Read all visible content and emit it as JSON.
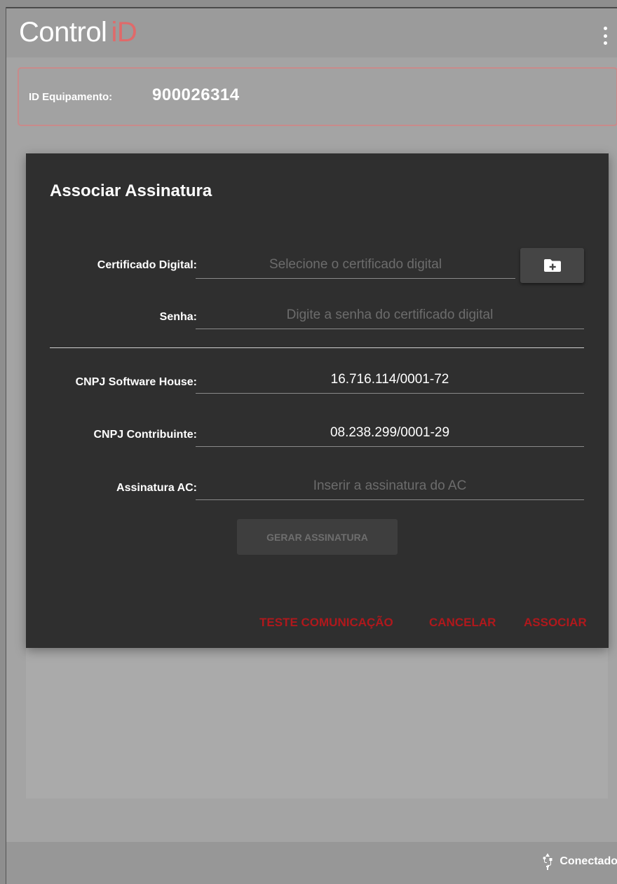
{
  "app": {
    "logo_main": "Control",
    "logo_accent": "iD",
    "menu_icon": "more-vert-icon"
  },
  "device": {
    "label": "ID Equipamento:",
    "value": "900026314"
  },
  "dialog": {
    "title": "Associar Assinatura",
    "fields": {
      "certificate_label": "Certificado Digital:",
      "certificate_placeholder": "Selecione o certificado digital",
      "certificate_button_icon": "folder-add-icon",
      "password_label": "Senha:",
      "password_placeholder": "Digite a senha do certificado digital",
      "cnpj_software_label": "CNPJ Software House:",
      "cnpj_software_value": "16.716.114/0001-72",
      "cnpj_taxpayer_label": "CNPJ Contribuinte:",
      "cnpj_taxpayer_value": "08.238.299/0001-29",
      "signature_label": "Assinatura AC:",
      "signature_placeholder": "Inserir a assinatura do AC"
    },
    "generate_button": "GERAR ASSINATURA",
    "actions": {
      "test": "TESTE COMUNICAÇÃO",
      "cancel": "CANCELAR",
      "associate": "ASSOCIAR"
    }
  },
  "status": {
    "icon": "usb-icon",
    "text": "Conectado"
  },
  "colors": {
    "accent_red": "#b0181c",
    "logo_accent": "#e06a6a",
    "dialog_bg": "#2f2f2f"
  }
}
